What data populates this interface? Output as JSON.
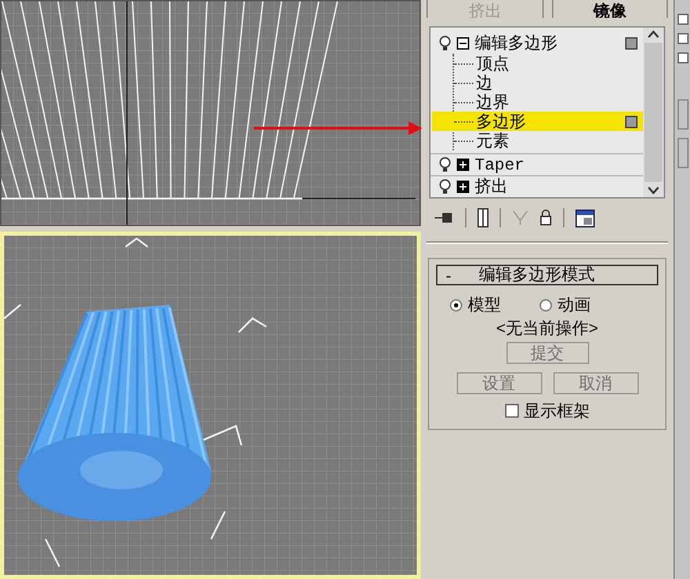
{
  "viewports": [
    {
      "active": false
    },
    {
      "active": true
    }
  ],
  "top_buttons": [
    {
      "label": "挤出",
      "disabled": true
    },
    {
      "label": "镜像",
      "disabled": false
    }
  ],
  "modifier_stack": {
    "items": [
      {
        "label": "编辑多边形",
        "expanded": true,
        "children": [
          {
            "label": "顶点",
            "selected": false
          },
          {
            "label": "边",
            "selected": false
          },
          {
            "label": "边界",
            "selected": false
          },
          {
            "label": "多边形",
            "selected": true
          },
          {
            "label": "元素",
            "selected": false
          }
        ]
      },
      {
        "label": "Taper",
        "expanded": false
      },
      {
        "label": "挤出",
        "expanded": false
      }
    ]
  },
  "rollout": {
    "collapse_symbol": "-",
    "title": "编辑多边形模式",
    "modes": [
      {
        "label": "模型",
        "selected": true
      },
      {
        "label": "动画",
        "selected": false
      }
    ],
    "status": "<无当前操作>",
    "commit": {
      "label": "提交",
      "disabled": true
    },
    "buttons": [
      {
        "label": "设置",
        "disabled": true
      },
      {
        "label": "取消",
        "disabled": true
      }
    ],
    "show_cage": {
      "label": "显示框架",
      "checked": false
    }
  }
}
